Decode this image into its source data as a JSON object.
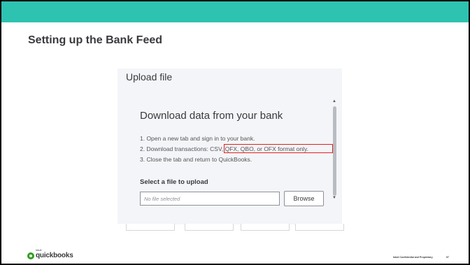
{
  "slide": {
    "title": "Setting up the Bank Feed",
    "footer_note": "Intuit Confidential and Proprietary",
    "page_number": "97",
    "logo_brand": "quickbooks",
    "logo_prefix": "intuit",
    "accent_color": "#2ec3b0"
  },
  "dialog": {
    "header": "Upload file",
    "heading": "Download data from your bank",
    "steps": [
      "1. Open a new tab and sign in to your bank.",
      "2. Download transactions: CSV, QFX, QBO, or OFX format only.",
      "3. Close the tab and return to QuickBooks."
    ],
    "select_label": "Select a file to upload",
    "file_placeholder": "No file selected",
    "browse_label": "Browse",
    "highlight_color": "#e02020"
  },
  "icons": [
    "scroll-up-icon",
    "scroll-down-icon",
    "quickbooks-logo-icon"
  ]
}
